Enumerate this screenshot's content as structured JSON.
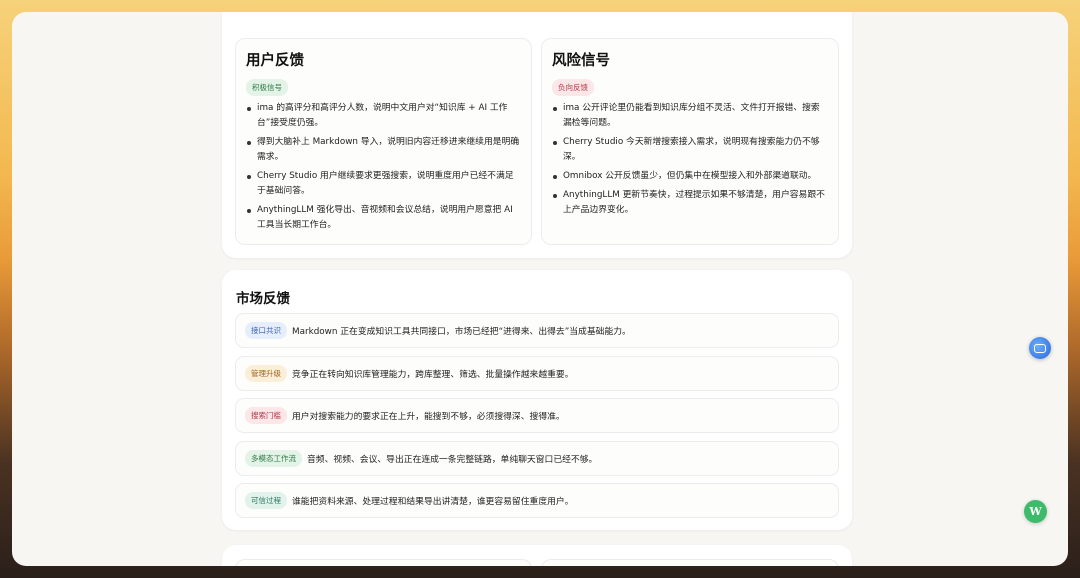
{
  "user_feedback": {
    "title": "用户反馈",
    "badge": "积极信号",
    "items": [
      "ima 的高评分和高评分人数，说明中文用户对“知识库 + AI 工作台”接受度仍强。",
      "得到大脑补上 Markdown 导入，说明旧内容迁移进来继续用是明确需求。",
      "Cherry Studio 用户继续要求更强搜索，说明重度用户已经不满足于基础问答。",
      "AnythingLLM 强化导出、音视频和会议总结，说明用户愿意把 AI 工具当长期工作台。"
    ]
  },
  "risk_signals": {
    "title": "风险信号",
    "badge": "负向反馈",
    "items": [
      "ima 公开评论里仍能看到知识库分组不灵活、文件打开报错、搜索漏检等问题。",
      "Cherry Studio 今天新增搜索接入需求，说明现有搜索能力仍不够深。",
      "Omnibox 公开反馈虽少，但仍集中在模型接入和外部渠道联动。",
      "AnythingLLM 更新节奏快，过程提示如果不够清楚，用户容易跟不上产品边界变化。"
    ]
  },
  "market_feedback": {
    "title": "市场反馈",
    "rows": [
      {
        "tag": "接口共识",
        "text": "Markdown 正在变成知识工具共同接口，市场已经把“进得来、出得去”当成基础能力。"
      },
      {
        "tag": "管理升级",
        "text": "竞争正在转向知识库管理能力，跨库整理、筛选、批量操作越来越重要。"
      },
      {
        "tag": "搜索门槛",
        "text": "用户对搜索能力的要求正在上升，能搜到不够，必须搜得深、搜得准。"
      },
      {
        "tag": "多模态工作流",
        "text": "音频、视频、会议、导出正在连成一条完整链路，单纯聊天窗口已经不够。"
      },
      {
        "tag": "可信过程",
        "text": "谁能把资料来源、处理过程和结果导出讲清楚，谁更容易留住重度用户。"
      }
    ]
  },
  "floating": {
    "w_label": "W"
  },
  "icons": {
    "float": "message-bubble-icon"
  }
}
